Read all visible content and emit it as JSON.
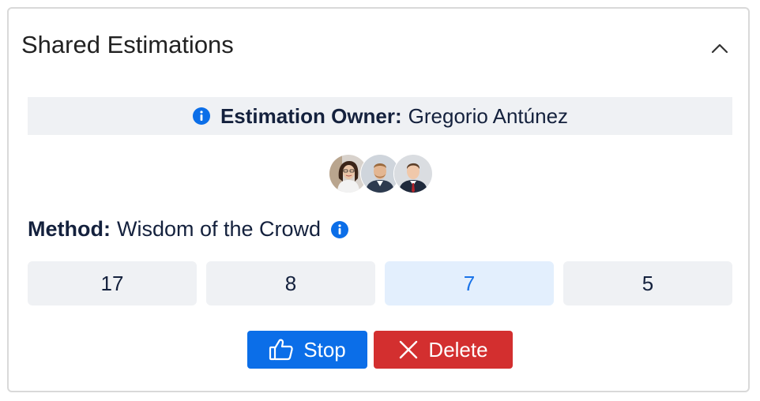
{
  "header": {
    "title": "Shared Estimations",
    "collapse_icon": "chevron-up-icon"
  },
  "owner": {
    "icon": "info-icon",
    "label": "Estimation Owner:",
    "name": "Gregorio Antúnez"
  },
  "participants": [
    {
      "avatar": "avatar-woman"
    },
    {
      "avatar": "avatar-man-beard"
    },
    {
      "avatar": "avatar-man-tie"
    }
  ],
  "method": {
    "label": "Method:",
    "value": "Wisdom of the Crowd",
    "icon": "info-icon"
  },
  "options": [
    {
      "value": "17",
      "selected": false
    },
    {
      "value": "8",
      "selected": false
    },
    {
      "value": "7",
      "selected": true
    },
    {
      "value": "5",
      "selected": false
    }
  ],
  "actions": {
    "stop_label": "Stop",
    "stop_icon": "thumbs-up-icon",
    "delete_label": "Delete",
    "delete_icon": "close-icon"
  },
  "colors": {
    "primary": "#0b6ee8",
    "danger": "#d32f2f",
    "selected_bg": "#e3effd",
    "selected_text": "#1a73e8",
    "option_bg": "#eff1f4"
  }
}
